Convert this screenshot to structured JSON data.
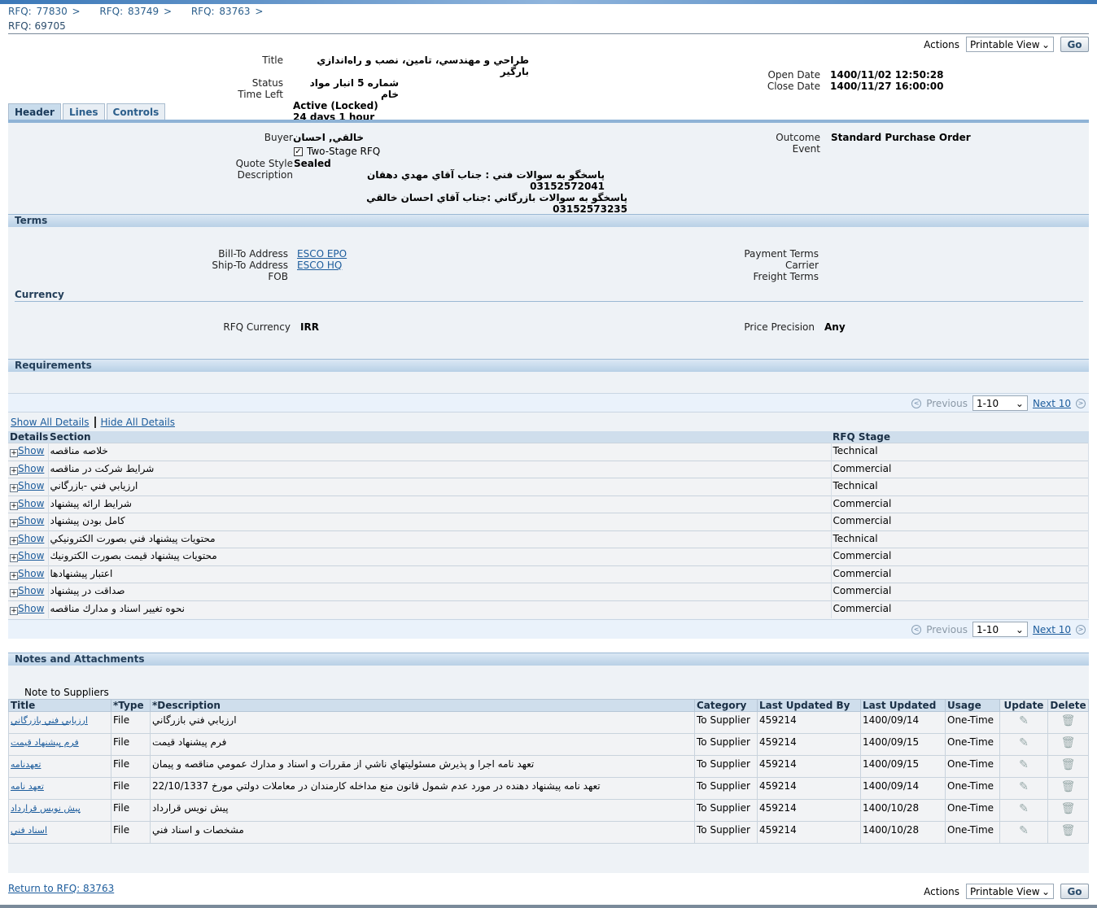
{
  "breadcrumbs": [
    "RFQ: 77830",
    "RFQ: 83749",
    "RFQ: 83763"
  ],
  "page_title": "RFQ: 69705",
  "actions": {
    "label": "Actions",
    "selected": "Printable View",
    "go": "Go"
  },
  "summary": {
    "title_label": "Title",
    "title_line1": "طراحي و مهندسي، تامين، نصب و راه‌اندازي بارگير",
    "title_line2": "شماره 5 انبار مواد خام",
    "status_label": "Status",
    "status": "Active (Locked)",
    "time_left_label": "Time Left",
    "time_left": "24 days 1 hour",
    "open_date_label": "Open Date",
    "open_date": "1400/11/02 12:50:28",
    "close_date_label": "Close Date",
    "close_date": "1400/11/27 16:00:00"
  },
  "tabs": [
    "Header",
    "Lines",
    "Controls"
  ],
  "header": {
    "buyer_label": "Buyer",
    "buyer": "خالقي, احسان",
    "two_stage": "Two-Stage RFQ",
    "two_stage_checked": true,
    "quote_style_label": "Quote Style",
    "quote_style": "Sealed",
    "description_label": "Description",
    "description_line1": "پاسخگو به سوالات فني : جناب آقاي مهدي دهقان 03152572041",
    "description_line2": "پاسخگو به سوالات بازرگاني :جناب آقاي احسان خالقي 03152573235",
    "outcome_label": "Outcome",
    "outcome": "Standard Purchase Order",
    "event_label": "Event"
  },
  "terms": {
    "title": "Terms",
    "bill_to_label": "Bill-To Address",
    "bill_to": "ESCO EPO",
    "ship_to_label": "Ship-To Address",
    "ship_to": "ESCO HQ",
    "fob_label": "FOB",
    "payment_terms_label": "Payment Terms",
    "carrier_label": "Carrier",
    "freight_terms_label": "Freight Terms",
    "currency_title": "Currency",
    "rfq_currency_label": "RFQ Currency",
    "rfq_currency": "IRR",
    "price_precision_label": "Price Precision",
    "price_precision": "Any"
  },
  "requirements": {
    "title": "Requirements",
    "previous": "Previous",
    "range": "1-10",
    "next": "Next 10",
    "show_all": "Show All Details",
    "hide_all": "Hide All Details",
    "columns": [
      "Details",
      "Section",
      "RFQ Stage"
    ],
    "show_label": "Show",
    "rows": [
      {
        "section": "خلاصه مناقصه",
        "stage": "Technical"
      },
      {
        "section": "شرايط شركت در مناقصه",
        "stage": "Commercial"
      },
      {
        "section": "ارزيابي فني -بازرگاني",
        "stage": "Technical"
      },
      {
        "section": "شرايط ارائه پيشنهاد",
        "stage": "Commercial"
      },
      {
        "section": "كامل بودن پيشنهاد",
        "stage": "Commercial"
      },
      {
        "section": "محتويات پيشنهاد فني بصورت الكترونيكي",
        "stage": "Technical"
      },
      {
        "section": "محتويات پيشنهاد قيمت بصورت الكترونيك",
        "stage": "Commercial"
      },
      {
        "section": "اعتبار پيشنهادها",
        "stage": "Commercial"
      },
      {
        "section": "صداقت در پيشنهاد",
        "stage": "Commercial"
      },
      {
        "section": "نحوه تغيير اسناد و مدارك مناقصه",
        "stage": "Commercial"
      }
    ]
  },
  "notes": {
    "title": "Notes and Attachments",
    "note_label": "Note to Suppliers",
    "columns": [
      "Title",
      "*Type",
      "*Description",
      "Category",
      "Last Updated By",
      "Last Updated",
      "Usage",
      "Update",
      "Delete"
    ],
    "rows": [
      {
        "title": "ارزيابي فني بازرگاني",
        "type": "File",
        "description": "ارزيابي فني بازرگاني",
        "category": "To Supplier",
        "by": "459214",
        "date": "1400/09/14",
        "usage": "One-Time"
      },
      {
        "title": "فرم پيشنهاد قيمت",
        "type": "File",
        "description": "فرم پيشنهاد قيمت",
        "category": "To Supplier",
        "by": "459214",
        "date": "1400/09/15",
        "usage": "One-Time"
      },
      {
        "title": "تعهدنامه",
        "type": "File",
        "description": "تعهد نامه اجرا و پذيرش مسئوليتهاي ناشي از مقررات و اسناد و مدارك عمومي مناقصه و پيمان",
        "category": "To Supplier",
        "by": "459214",
        "date": "1400/09/15",
        "usage": "One-Time"
      },
      {
        "title": "تعهد نامه",
        "type": "File",
        "description": "تعهد نامه پيشنهاد دهنده در مورد عدم شمول قانون منع مداخله كارمندان در معاملات دولتي مورخ 22/10/1337",
        "category": "To Supplier",
        "by": "459214",
        "date": "1400/09/14",
        "usage": "One-Time"
      },
      {
        "title": "پيش نويس قرارداد",
        "type": "File",
        "description": "پيش نويس قرارداد",
        "category": "To Supplier",
        "by": "459214",
        "date": "1400/10/28",
        "usage": "One-Time"
      },
      {
        "title": "اسناد فني",
        "type": "File",
        "description": "مشخصات و اسناد فني",
        "category": "To Supplier",
        "by": "459214",
        "date": "1400/10/28",
        "usage": "One-Time"
      }
    ]
  },
  "footer": {
    "return_link": "Return to RFQ: 83763"
  }
}
